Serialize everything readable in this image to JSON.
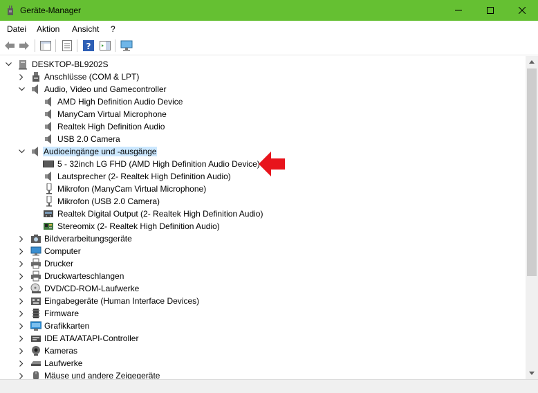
{
  "window": {
    "title": "Geräte-Manager"
  },
  "menu": {
    "items": [
      "Datei",
      "Aktion",
      "Ansicht",
      "?"
    ]
  },
  "tree": {
    "root": "DESKTOP-BL9202S",
    "nodes": [
      {
        "label": "Anschlüsse (COM & LPT)",
        "icon": "port-icon"
      },
      {
        "label": "Audio, Video und Gamecontroller",
        "icon": "speaker-icon",
        "expanded": true
      },
      {
        "label": "AMD High Definition Audio Device",
        "icon": "speaker-icon"
      },
      {
        "label": "ManyCam Virtual Microphone",
        "icon": "speaker-icon"
      },
      {
        "label": "Realtek High Definition Audio",
        "icon": "speaker-icon"
      },
      {
        "label": "USB 2.0 Camera",
        "icon": "speaker-icon"
      },
      {
        "label": "Audioeingänge und -ausgänge",
        "icon": "speaker-icon",
        "expanded": true,
        "selected": true
      },
      {
        "label": "5 - 32inch LG FHD (AMD High Definition Audio Device)",
        "icon": "monitor-icon"
      },
      {
        "label": "Lautsprecher (2- Realtek High Definition Audio)",
        "icon": "speaker-icon"
      },
      {
        "label": "Mikrofon (ManyCam Virtual Microphone)",
        "icon": "microphone-icon"
      },
      {
        "label": "Mikrofon (USB 2.0 Camera)",
        "icon": "microphone-icon"
      },
      {
        "label": "Realtek Digital Output (2- Realtek High Definition Audio)",
        "icon": "digital-output-icon"
      },
      {
        "label": "Stereomix (2- Realtek High Definition Audio)",
        "icon": "circuit-board-icon"
      },
      {
        "label": "Bildverarbeitungsgeräte",
        "icon": "camera-icon"
      },
      {
        "label": "Computer",
        "icon": "computer-icon"
      },
      {
        "label": "Drucker",
        "icon": "printer-icon"
      },
      {
        "label": "Druckwarteschlangen",
        "icon": "printer-icon"
      },
      {
        "label": "DVD/CD-ROM-Laufwerke",
        "icon": "disc-drive-icon"
      },
      {
        "label": "Eingabegeräte (Human Interface Devices)",
        "icon": "hid-icon"
      },
      {
        "label": "Firmware",
        "icon": "chip-icon"
      },
      {
        "label": "Grafikkarten",
        "icon": "display-adapter-icon"
      },
      {
        "label": "IDE ATA/ATAPI-Controller",
        "icon": "ide-controller-icon"
      },
      {
        "label": "Kameras",
        "icon": "webcam-icon"
      },
      {
        "label": "Laufwerke",
        "icon": "drive-icon"
      },
      {
        "label": "Mäuse und andere Zeigegeräte",
        "icon": "mouse-icon"
      }
    ]
  },
  "colors": {
    "titlebar": "#65c032",
    "selection": "#cce8ff",
    "arrow": "#e8141c"
  }
}
